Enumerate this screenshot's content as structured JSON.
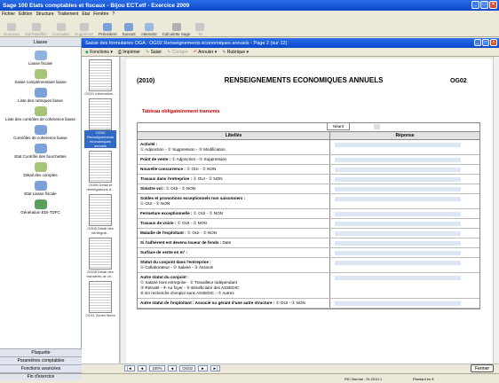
{
  "window": {
    "title": "Sage 100 Etats comptables et fiscaux - Bijou ECT.etf - Exercice 2009"
  },
  "menu": [
    "Fichier",
    "Edition",
    "Structure",
    "Traitement",
    "Etat",
    "Fenêtre",
    "?"
  ],
  "toolbar": [
    {
      "label": "Nouveau",
      "enabled": false
    },
    {
      "label": "Voir/Modifier",
      "enabled": false
    },
    {
      "label": "Consulter",
      "enabled": false
    },
    {
      "label": "Supprimer",
      "enabled": false
    },
    {
      "label": "Précédent",
      "enabled": true
    },
    {
      "label": "Suivant",
      "enabled": true
    },
    {
      "label": "Atteindre",
      "enabled": true
    },
    {
      "label": "Calculette Sage",
      "enabled": true
    },
    {
      "label": "Tri",
      "enabled": false
    }
  ],
  "sidebar": {
    "title": "Liasse",
    "items": [
      "Liasse fiscale",
      "Saisie complémentaire liasse",
      "Liste des rubriques liasse",
      "Liste des contrôles de cohérence liasse",
      "Contrôles de cohérence liasse",
      "Etat Contrôle des fourchettes",
      "Détail des comptes",
      "Etat Liasse fiscale",
      "Génération EDI-TDFC"
    ],
    "footer": [
      "Plaquette",
      "Paramètres comptables",
      "Fonctions avancées",
      "Fin d'exercice"
    ]
  },
  "doc": {
    "title": "Saisie des formulaires OGA : OG02 Renseignements économiques annuels - Page 2 (sur 12)",
    "toolbar": {
      "fonctions": "Fonctions",
      "imprimer": "Imprimer",
      "saisir": "Saisir",
      "corriger": "Corriger",
      "annuler": "Annuler",
      "rubrique": "Rubrique"
    }
  },
  "thumbs": [
    {
      "label": "OG01 Information...",
      "selected": false
    },
    {
      "label": "OG02 Renseignements économiques annuels",
      "selected": true
    },
    {
      "label": "OG05 Détail et réintégrations d...",
      "selected": false
    },
    {
      "label": "OG06 Détail des réintégrat...",
      "selected": false
    },
    {
      "label": "OG08 Détail des transferts de ch...",
      "selected": false
    },
    {
      "label": "OG11 Zones libres",
      "selected": false
    }
  ],
  "page": {
    "year": "(2010)",
    "title": "RENSEIGNEMENTS ECONOMIQUES ANNUELS",
    "code": "OG02",
    "obligatoire": "Tableau obligatoirement transmis",
    "neant": "Néant",
    "col_libelles": "Libellés",
    "col_reponse": "Réponse",
    "rows": [
      {
        "t": "Activité :",
        "o": "① Adjonction   -   ② Suppression   -   ③ Modification"
      },
      {
        "t": "Point de vente :",
        "o": "① Adjonction   -   ② Suppression",
        "inline": true
      },
      {
        "t": "Nouvelle concurrence :",
        "o": "① OUI   -   ② NON",
        "inline": true
      },
      {
        "t": "Travaux dans l'entreprise :",
        "o": "① OUI   -   ② NON",
        "inline": true
      },
      {
        "t": "Sinistre vol :",
        "o": "① OUI   -   ② NON",
        "inline": true
      },
      {
        "t": "Soldes et promotions exceptionnels non saisonniers :",
        "o": "① OUI   -   ② NON"
      },
      {
        "t": "Fermeture exceptionnelle :",
        "o": "① OUI   -   ② NON",
        "inline": true
      },
      {
        "t": "Travaux de voirie :",
        "o": "① OUI   -   ② NON",
        "inline": true
      },
      {
        "t": "Maladie de l'exploitant :",
        "o": "① OUI   -   ② NON",
        "inline": true
      },
      {
        "t": "Si l'adhérent est devenu loueur de fonds :",
        "o": "Date",
        "inline": true
      },
      {
        "t": "Surface de vente en m² :",
        "o": "",
        "inline": true
      },
      {
        "t": "Statut du conjoint dans l'entreprise :",
        "o": "① Collaborateur   -   ② Salarié   -   ③ Associé"
      },
      {
        "t": "Autre statut du conjoint :",
        "o": "① Salarié hors entreprise   -   ② Travailleur indépendant",
        "o2": "③ Retraité   -   ④ Au foyer   -   ⑤ Bénéficiaire des ASSEDIC",
        "o3": "⑥ En recherche d'emploi sans ASSEDIC   -   ⑦ Autres"
      },
      {
        "t": "Autre statut de l'exploitant : Associé ou gérant d'une autre structure :",
        "o": "① OUI   -   ② NON",
        "inline": true
      }
    ]
  },
  "hbar": {
    "zoom": "100%",
    "page": "OG02"
  },
  "fermer": "Fermer",
  "status": {
    "s1": "RIC Normal : 31.2010-1",
    "s2": "Plantant en €"
  },
  "colors": {
    "title_bar": "#0a48c8",
    "selected": "#316ac5",
    "mandatory": "#c00000"
  }
}
